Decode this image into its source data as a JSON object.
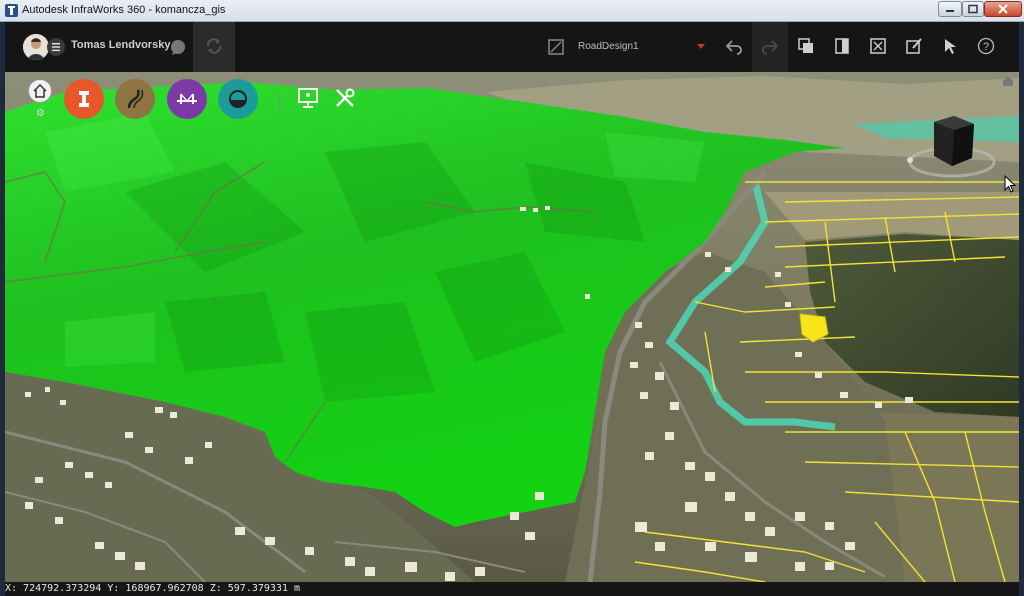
{
  "window": {
    "title": "Autodesk InfraWorks 360 - komancza_gis"
  },
  "toolbar": {
    "username": "Tomas Lendvorsky",
    "proposal": "RoadDesign1",
    "icons": [
      "user-menu-icon",
      "chat-icon",
      "sync-icon",
      "proposal-icon",
      "undo-icon",
      "redo-icon",
      "layers-icon",
      "panels-icon",
      "fullscreen-icon",
      "sketch-icon",
      "select-icon",
      "help-icon"
    ]
  },
  "tools": {
    "circles": [
      {
        "name": "roads-tool",
        "color": "#e8572a"
      },
      {
        "name": "road-design-tool",
        "color": "#8e7440"
      },
      {
        "name": "bridge-tool",
        "color": "#7d3aa6"
      },
      {
        "name": "drainage-tool",
        "color": "#1d9a9a"
      }
    ]
  },
  "status": {
    "coordinates": "X: 724792.373294 Y: 168967.962708 Z: 597.379331 m"
  },
  "colors": {
    "terrain_highlight": "#22d322",
    "parcel_lines": "#f2e335",
    "river": "#4fd8b6"
  }
}
